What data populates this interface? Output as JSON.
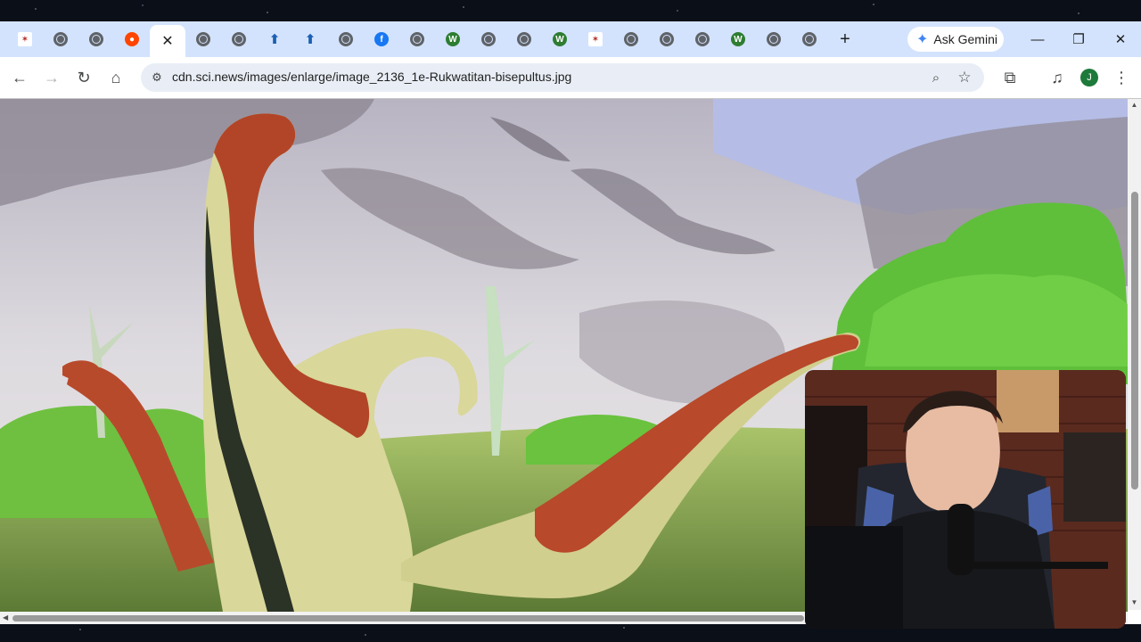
{
  "browser": {
    "tabs": [
      {
        "icon": "sun-logo-icon",
        "active": false
      },
      {
        "icon": "globe-icon",
        "active": false
      },
      {
        "icon": "globe-icon",
        "active": false
      },
      {
        "icon": "reddit-icon",
        "active": false
      },
      {
        "icon": "close-icon",
        "active": true
      },
      {
        "icon": "globe-icon",
        "active": false
      },
      {
        "icon": "globe-icon",
        "active": false
      },
      {
        "icon": "bolt-icon",
        "active": false
      },
      {
        "icon": "bolt-icon",
        "active": false
      },
      {
        "icon": "globe-icon",
        "active": false
      },
      {
        "icon": "facebook-icon",
        "active": false
      },
      {
        "icon": "globe-icon",
        "active": false
      },
      {
        "icon": "wiki-icon",
        "active": false
      },
      {
        "icon": "globe-icon",
        "active": false
      },
      {
        "icon": "globe-icon",
        "active": false
      },
      {
        "icon": "wiki-icon",
        "active": false
      },
      {
        "icon": "sun-logo-icon",
        "active": false
      },
      {
        "icon": "globe-icon",
        "active": false
      },
      {
        "icon": "globe-icon",
        "active": false
      },
      {
        "icon": "globe-icon",
        "active": false
      },
      {
        "icon": "wiki-icon",
        "active": false
      },
      {
        "icon": "globe-icon",
        "active": false
      },
      {
        "icon": "globe-icon",
        "active": false
      }
    ],
    "ask_gemini_label": "Ask Gemini",
    "url": "cdn.sci.news/images/enlarge/image_2136_1e-Rukwatitan-bisepultus.jpg",
    "profile_initial": "J",
    "colors": {
      "tabstrip": "#d3e3fd",
      "omnibox": "#e9eef6",
      "avatar": "#1e7a3a"
    }
  },
  "content": {
    "image_subject": "sauropod dinosaurs illustration",
    "webcam_overlay": true
  }
}
